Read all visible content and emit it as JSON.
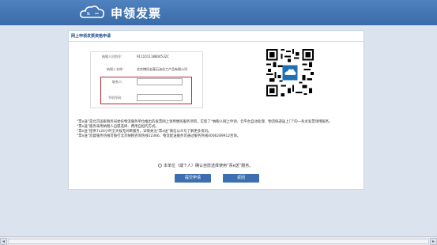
{
  "header": {
    "app_title": "申领发票"
  },
  "panel": {
    "title": "网上申领发票资格申请",
    "fields": {
      "taxpayer_id_label": "纳税人识别号：",
      "taxpayer_id_value": "911101118804532C",
      "taxpayer_name_label": "纳税人名称：",
      "taxpayer_name_value": "北京博氏宏泰石油化工产品有限公司",
      "contact_label": "联系人：",
      "phone_label": "手机号码："
    },
    "description": [
      "“票e送”是北京国家税务局委托物流服务单位推出的发票网上领用便民服务项目，实现了“纳税人网上申领、云平台自动处理、物流快递送上门”的一条龙发票领用服务。",
      "“票e送”服务采用纳税人自愿选择、费用自担的方式。",
      "“票e送”提供7x24小时全天候无间断服务，详情关注“票e送”微信公众号了解更多资讯。",
      "“票e送”监督服务热线可拨打北京纳税咨询热线12366、物流配送服务可通过服务热线4006289912咨询。"
    ],
    "consent_text": "本单位（或个人）确认自愿选择使用“票e送”服务。",
    "submit_label": "提交申请",
    "back_label": "返回"
  },
  "colors": {
    "accent": "#3d6fb0",
    "highlight": "#c0282d"
  }
}
